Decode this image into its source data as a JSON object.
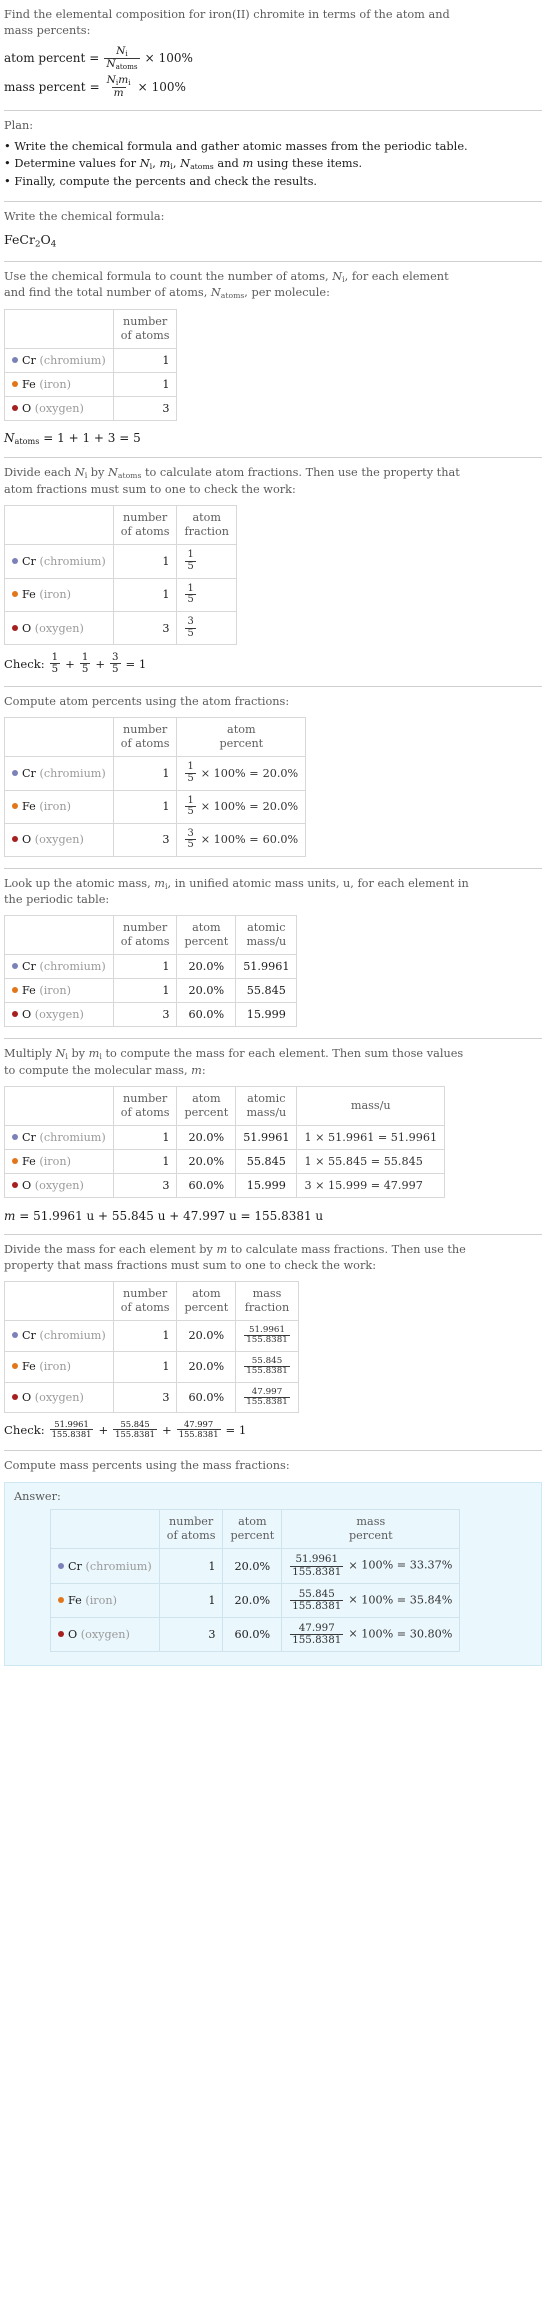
{
  "intro": {
    "line1": "Find the elemental composition for iron(II) chromite in terms of the atom and",
    "line2": "mass percents:",
    "atom_percent_label": "atom percent",
    "mass_percent_label": "mass percent",
    "equals": "=",
    "times": "×",
    "hundred": "100%",
    "ni": "N",
    "ni_sub": "i",
    "natoms": "N",
    "natoms_sub": "atoms",
    "mi": "m",
    "mi_sub": "i",
    "m": "m"
  },
  "plan": {
    "title": "Plan:",
    "bullet": "•",
    "items": [
      "Write the chemical formula and gather atomic masses from the periodic table.",
      "Determine values for N_i, m_i, N_atoms and m using these items.",
      "Finally, compute the percents and check the results."
    ],
    "item2_pre": "Determine values for ",
    "item2_mid": " and ",
    "item2_post": " using these items.",
    "item3": "Finally, compute the percents and check the results.",
    "item1": "Write the chemical formula and gather atomic masses from the periodic table."
  },
  "formula_step": {
    "prompt": "Write the chemical formula:",
    "formula_parts": [
      {
        "text": "FeCr",
        "type": "base"
      },
      {
        "text": "2",
        "type": "sub"
      },
      {
        "text": "O",
        "type": "base"
      },
      {
        "text": "4",
        "type": "sub"
      }
    ],
    "formula_plain": "FeCr2O4"
  },
  "count_step": {
    "prompt_line1": "Use the chemical formula to count the number of atoms, N_i, for each element",
    "prompt_line2": "and find the total number of atoms, N_atoms, per molecule:",
    "p1a": "Use the chemical formula to count the number of atoms, ",
    "p1b": ", for each element",
    "p2a": "and find the total number of atoms, ",
    "p2b": ", per molecule:",
    "header_number_of_atoms": [
      "number",
      "of atoms"
    ],
    "total_expr": " = 1 + 1 + 3 = 5",
    "total_value": "5"
  },
  "elements": [
    {
      "symbol": "Cr",
      "name": "(chromium)",
      "color": "#7b82b8",
      "count": "1",
      "fraction_num": "1",
      "fraction_den": "5",
      "atom_percent": "20.0%",
      "atomic_mass": "51.9961",
      "mass_expr": "1 × 51.9961 = 51.9961",
      "mass_value": "51.9961",
      "mass_percent": "33.37%"
    },
    {
      "symbol": "Fe",
      "name": "(iron)",
      "color": "#e2761b",
      "count": "1",
      "fraction_num": "1",
      "fraction_den": "5",
      "atom_percent": "20.0%",
      "atomic_mass": "55.845",
      "mass_expr": "1 × 55.845 = 55.845",
      "mass_value": "55.845",
      "mass_percent": "35.84%"
    },
    {
      "symbol": "O",
      "name": "(oxygen)",
      "color": "#a62020",
      "count": "3",
      "fraction_num": "3",
      "fraction_den": "5",
      "atom_percent": "60.0%",
      "atomic_mass": "15.999",
      "mass_expr": "3 × 15.999 = 47.997",
      "mass_value": "47.997",
      "mass_percent": "30.80%"
    }
  ],
  "fraction_step": {
    "prompt_line1": "Divide each N_i by N_atoms to calculate atom fractions. Then use the property that",
    "prompt_line2": "atom fractions must sum to one to check the work:",
    "p1a": "Divide each ",
    "p1b": " by ",
    "p1c": " to calculate atom fractions. Then use the property that",
    "p2": "atom fractions must sum to one to check the work:",
    "header_atom_fraction": [
      "atom",
      "fraction"
    ],
    "check_label": "Check:",
    "check_result": " = 1",
    "plus": "+"
  },
  "atom_percent_step": {
    "prompt": "Compute atom percents using the atom fractions:",
    "header_atom_percent": [
      "atom",
      "percent"
    ],
    "times": "× 100% =",
    "results": [
      "20.0%",
      "20.0%",
      "60.0%"
    ]
  },
  "atomic_mass_step": {
    "prompt_line1": "Look up the atomic mass, m_i, in unified atomic mass units, u, for each element in",
    "prompt_line2": "the periodic table:",
    "p1a": "Look up the atomic mass, ",
    "p1b": ", in unified atomic mass units, u, for each element in",
    "p2": "the periodic table:",
    "header_atomic_mass": [
      "atomic",
      "mass/u"
    ]
  },
  "mass_step": {
    "prompt_line1": "Multiply N_i by m_i to compute the mass for each element. Then sum those values",
    "prompt_line2": "to compute the molecular mass, m:",
    "p1a": "Multiply ",
    "p1b": " by ",
    "p1c": " to compute the mass for each element. Then sum those values",
    "p2a": "to compute the molecular mass, ",
    "p2b": ":",
    "header_mass": "mass/u",
    "molecular_mass_expr": " = 51.9961 u + 55.845 u + 47.997 u = 155.8381 u",
    "molecular_mass_value": "155.8381",
    "unit": "u"
  },
  "mass_fraction_step": {
    "prompt_line1": "Divide the mass for each element by m to calculate mass fractions. Then use the",
    "prompt_line2": "property that mass fractions must sum to one to check the work:",
    "p1a": "Divide the mass for each element by ",
    "p1b": " to calculate mass fractions. Then use the",
    "p2": "property that mass fractions must sum to one to check the work:",
    "header_mass_fraction": [
      "mass",
      "fraction"
    ],
    "denominator": "155.8381",
    "check_label": "Check:",
    "check_result": " = 1",
    "plus": "+"
  },
  "answer_step": {
    "prompt": "Compute mass percents using the mass fractions:",
    "answer_label": "Answer:",
    "header_mass_percent": [
      "mass",
      "percent"
    ],
    "denominator": "155.8381",
    "times": "×",
    "hundred_eq": "100% ="
  },
  "headers": {
    "number_of_atoms": [
      "number",
      "of atoms"
    ]
  }
}
